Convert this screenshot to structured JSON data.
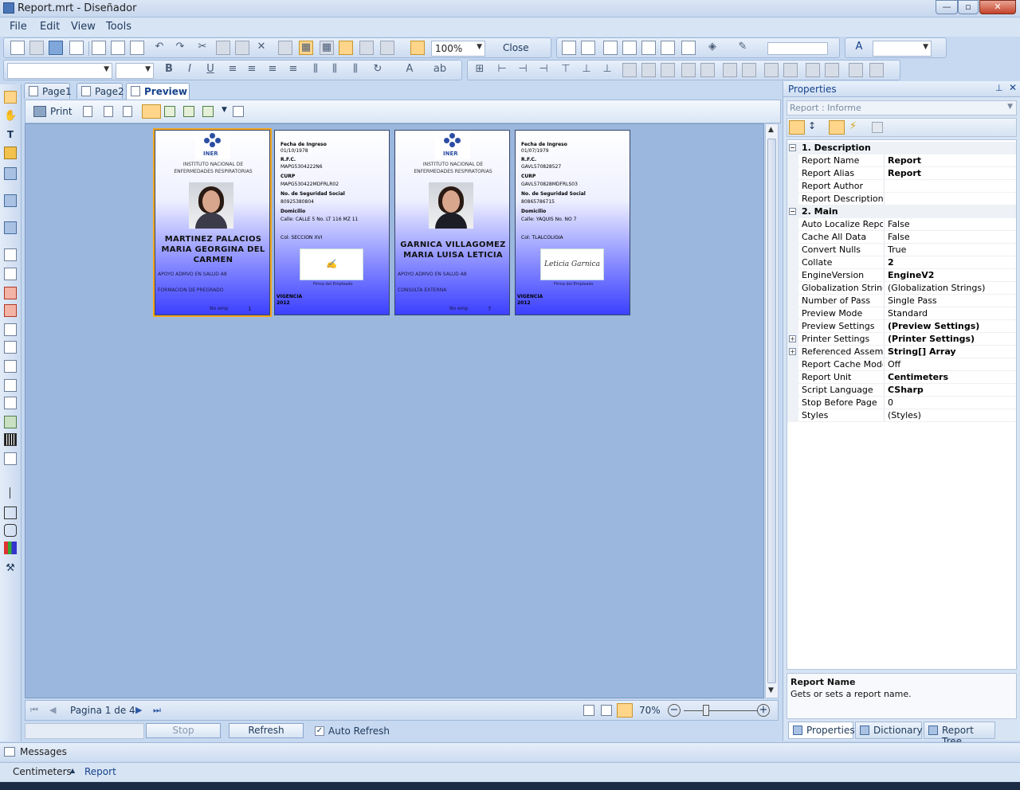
{
  "window": {
    "title": "Report.mrt - Diseñador",
    "controls": [
      "—",
      "▫",
      "✕"
    ]
  },
  "menu": [
    "File",
    "Edit",
    "View",
    "Tools"
  ],
  "toolbar": {
    "zoom": "100%",
    "close_label": "Close"
  },
  "tabs": [
    {
      "label": "Page1",
      "active": false
    },
    {
      "label": "Page2",
      "active": false
    },
    {
      "label": "Preview",
      "active": true
    }
  ],
  "preview": {
    "print_label": "Print",
    "pagination": "Pagina 1 de 4",
    "zoom": "70%",
    "stop_label": "Stop",
    "refresh_label": "Refresh",
    "auto_refresh_label": "Auto Refresh",
    "auto_refresh_checked": true
  },
  "cards": {
    "institute_logo": "INER",
    "institute_name_line1": "INSTITUTO NACIONAL DE",
    "institute_name_line2": "ENFERMEDADES RESPIRATORIAS",
    "front1": {
      "name_line1": "MARTINEZ PALACIOS",
      "name_line2": "MARIA GEORGINA DEL",
      "name_line3": "CARMEN",
      "position": "APOYO ADMVO EN SALUD A8",
      "area": "FORMACION DE PREGRADO",
      "no_emp_label": "No emp",
      "no_emp": "1"
    },
    "back1": {
      "fecha_label": "Fecha de Ingreso",
      "fecha": "01/10/1978",
      "rfc_label": "R.F.C.",
      "rfc": "MAPG5304222N6",
      "curp_label": "CURP",
      "curp": "MAPG530422MDFRLR02",
      "nss_label": "No. de Seguridad Social",
      "nss": "80925380804",
      "dom_label": "Domicilio",
      "dom": "Calle: CALLE 5 No. LT 116 MZ 11",
      "col": "Col: SECCION XVI",
      "firma": "Firma del Empleado",
      "vigencia": "VIGENCIA",
      "year": "2012"
    },
    "front2": {
      "name_line1": "GARNICA VILLAGOMEZ",
      "name_line2": "MARIA LUISA LETICIA",
      "position": "APOYO ADMVO EN SALUD A8",
      "area": "CONSULTA EXTERNA",
      "no_emp_label": "No emp",
      "no_emp": "7"
    },
    "back2": {
      "fecha_label": "Fecha de Ingreso",
      "fecha": "01/07/1979",
      "rfc_label": "R.F.C.",
      "rfc": "GAVL570828527",
      "curp_label": "CURP",
      "curp": "GAVL570828MDFRLS03",
      "nss_label": "No. de Seguridad Social",
      "nss": "80865786715",
      "dom_label": "Domicilio",
      "dom": "Calle: YAQUIS No. NO 7",
      "col": "Col: TLALCOLIGIA",
      "firma": "Firma del Empleado",
      "signature": "Leticia Garnica",
      "vigencia": "VIGENCIA",
      "year": "2012"
    }
  },
  "properties": {
    "header": "Properties",
    "object": "Report : Informe",
    "categories": [
      {
        "name": "1. Description",
        "rows": [
          {
            "name": "Report Name",
            "value": "Report",
            "bold": true
          },
          {
            "name": "Report Alias",
            "value": "Report",
            "bold": true
          },
          {
            "name": "Report Author",
            "value": ""
          },
          {
            "name": "Report Description",
            "value": ""
          }
        ]
      },
      {
        "name": "2. Main",
        "rows": [
          {
            "name": "Auto Localize Report",
            "value": "False"
          },
          {
            "name": "Cache All Data",
            "value": "False"
          },
          {
            "name": "Convert Nulls",
            "value": "True"
          },
          {
            "name": "Collate",
            "value": "2",
            "bold": true
          },
          {
            "name": "EngineVersion",
            "value": "EngineV2",
            "bold": true
          },
          {
            "name": "Globalization Strings",
            "value": "(Globalization Strings)"
          },
          {
            "name": "Number of Pass",
            "value": "Single Pass"
          },
          {
            "name": "Preview Mode",
            "value": "Standard"
          },
          {
            "name": "Preview Settings",
            "value": "(Preview Settings)",
            "bold": true
          },
          {
            "name": "Printer Settings",
            "value": "(Printer Settings)",
            "bold": true,
            "expandable": true
          },
          {
            "name": "Referenced Assembl",
            "value": "String[] Array",
            "bold": true,
            "expandable": true
          },
          {
            "name": "Report Cache Mode",
            "value": "Off"
          },
          {
            "name": "Report Unit",
            "value": "Centimeters",
            "bold": true
          },
          {
            "name": "Script Language",
            "value": "CSharp",
            "bold": true
          },
          {
            "name": "Stop Before Page",
            "value": "0"
          },
          {
            "name": "Styles",
            "value": "(Styles)"
          }
        ]
      }
    ],
    "description_title": "Report Name",
    "description_text": "Gets or sets a report name.",
    "bottom_tabs": [
      "Properties",
      "Dictionary",
      "Report Tree"
    ]
  },
  "messages_label": "Messages",
  "status": {
    "unit": "Centimeters",
    "component": "Report"
  }
}
